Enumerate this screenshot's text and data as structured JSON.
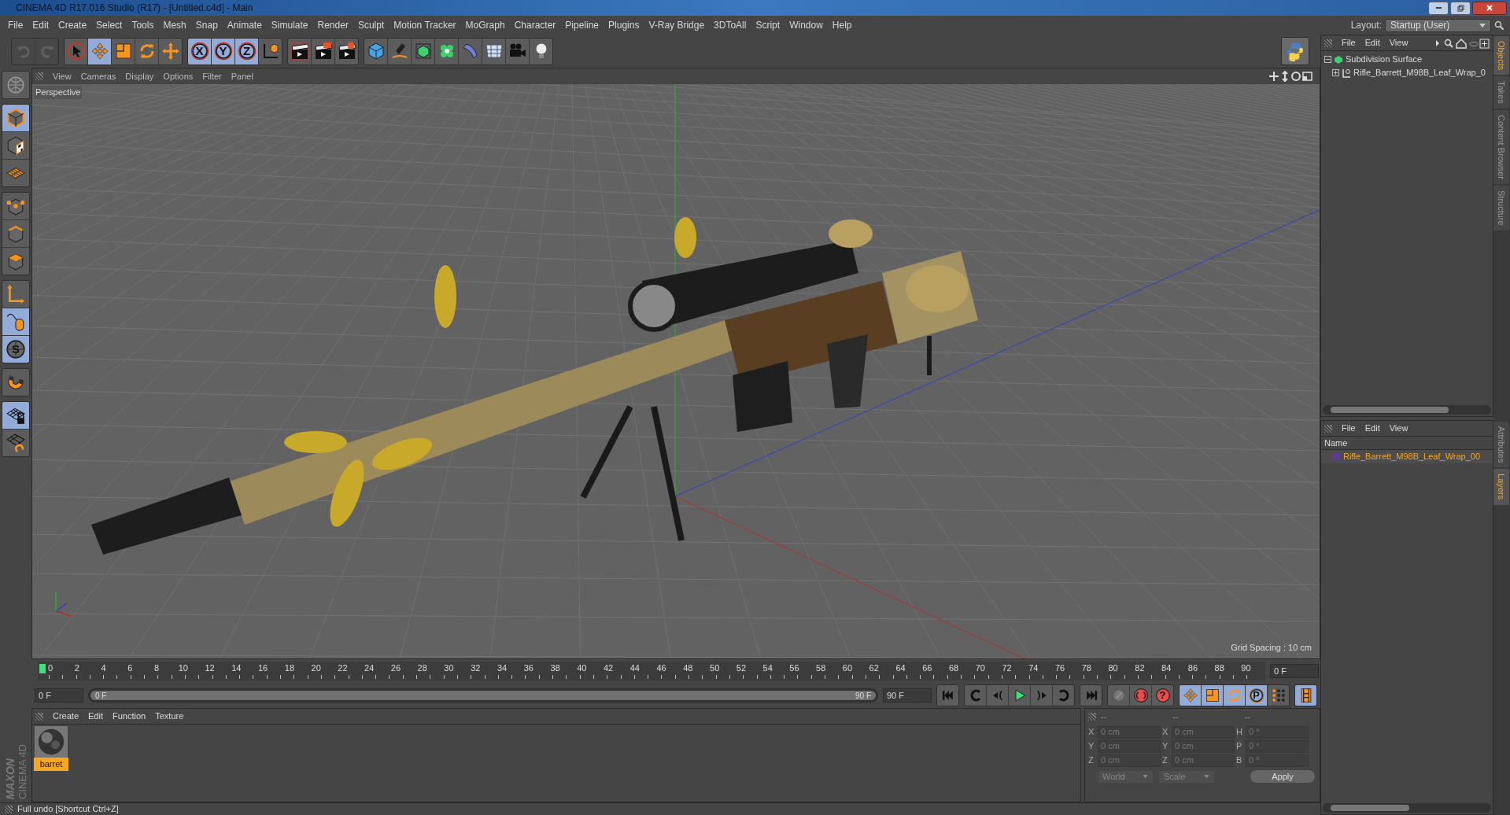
{
  "window": {
    "title": "CINEMA 4D R17.016 Studio (R17) - [Untitled.c4d] - Main"
  },
  "menu": [
    "File",
    "Edit",
    "Create",
    "Select",
    "Tools",
    "Mesh",
    "Snap",
    "Animate",
    "Simulate",
    "Render",
    "Sculpt",
    "Motion Tracker",
    "MoGraph",
    "Character",
    "Pipeline",
    "Plugins",
    "V-Ray Bridge",
    "3DToAll",
    "Script",
    "Window",
    "Help"
  ],
  "layout": {
    "label": "Layout:",
    "value": "Startup (User)"
  },
  "toolbar": [
    [
      {
        "kind": "undo",
        "disabled": true,
        "selected": false
      },
      {
        "kind": "redo",
        "disabled": true,
        "selected": false
      }
    ],
    [
      {
        "kind": "select",
        "disabled": false,
        "selected": false
      },
      {
        "kind": "move",
        "disabled": false,
        "selected": true
      },
      {
        "kind": "scale",
        "disabled": false,
        "selected": false
      },
      {
        "kind": "rotate",
        "disabled": false,
        "selected": false
      },
      {
        "kind": "add",
        "disabled": false,
        "selected": false
      }
    ],
    [
      {
        "kind": "axis",
        "label": "X",
        "disabled": false,
        "selected": true
      },
      {
        "kind": "axis",
        "label": "Y",
        "disabled": false,
        "selected": true
      },
      {
        "kind": "axis",
        "label": "Z",
        "disabled": false,
        "selected": true
      },
      {
        "kind": "coord",
        "disabled": false,
        "selected": false
      }
    ],
    [
      {
        "kind": "renderview",
        "disabled": false,
        "selected": false
      },
      {
        "kind": "render",
        "disabled": false,
        "selected": false
      },
      {
        "kind": "rendersettings",
        "disabled": false,
        "selected": false
      }
    ],
    [
      {
        "kind": "cube",
        "disabled": false,
        "selected": false
      },
      {
        "kind": "pen",
        "disabled": false,
        "selected": false
      },
      {
        "kind": "subdiv",
        "disabled": false,
        "selected": false
      },
      {
        "kind": "cloner",
        "disabled": false,
        "selected": false
      },
      {
        "kind": "deformer",
        "disabled": false,
        "selected": false
      },
      {
        "kind": "floor",
        "disabled": false,
        "selected": false
      },
      {
        "kind": "camera",
        "disabled": false,
        "selected": false
      },
      {
        "kind": "light",
        "disabled": false,
        "selected": false
      }
    ]
  ],
  "left_tools": [
    [
      {
        "kind": "globe",
        "selected": false
      }
    ],
    [
      {
        "kind": "model",
        "selected": true
      },
      {
        "kind": "texture",
        "selected": false
      },
      {
        "kind": "workplane",
        "selected": false
      }
    ],
    [
      {
        "kind": "points",
        "selected": false
      },
      {
        "kind": "edges",
        "selected": false
      },
      {
        "kind": "polygons",
        "selected": false
      }
    ],
    [
      {
        "kind": "axisl",
        "selected": false
      },
      {
        "kind": "mouse",
        "selected": true
      },
      {
        "kind": "snap",
        "label": "S",
        "selected": true
      }
    ],
    [
      {
        "kind": "magnet",
        "selected": false
      }
    ],
    [
      {
        "kind": "gridlock",
        "selected": true
      },
      {
        "kind": "gridsync",
        "selected": false
      }
    ]
  ],
  "viewport": {
    "menu": [
      "View",
      "Cameras",
      "Display",
      "Options",
      "Filter",
      "Panel"
    ],
    "camera": "Perspective",
    "grid_spacing": "Grid Spacing : 10 cm"
  },
  "timeline": {
    "ticks": [
      "0",
      "2",
      "4",
      "6",
      "8",
      "10",
      "12",
      "14",
      "16",
      "18",
      "20",
      "22",
      "24",
      "26",
      "28",
      "30",
      "32",
      "34",
      "36",
      "38",
      "40",
      "42",
      "44",
      "46",
      "48",
      "50",
      "52",
      "54",
      "56",
      "58",
      "60",
      "62",
      "64",
      "66",
      "68",
      "70",
      "72",
      "74",
      "76",
      "78",
      "80",
      "82",
      "84",
      "86",
      "88",
      "90"
    ],
    "playhead": {
      "level": 0
    },
    "current": "0 F",
    "start": "0 F",
    "range": {
      "from": "0 F",
      "to": "90 F",
      "level": 1
    },
    "end": "90 F"
  },
  "transport": [
    [
      {
        "kind": "first",
        "selected": false
      }
    ],
    [
      {
        "kind": "prevkey",
        "selected": false
      },
      {
        "kind": "prevframe",
        "selected": false
      },
      {
        "kind": "play",
        "selected": false
      },
      {
        "kind": "nextframe",
        "selected": false
      },
      {
        "kind": "nextkey",
        "selected": false
      }
    ],
    [
      {
        "kind": "last",
        "selected": false
      }
    ],
    [
      {
        "kind": "recordoff",
        "selected": false
      },
      {
        "kind": "autokey",
        "selected": false
      },
      {
        "kind": "help",
        "label": "?",
        "selected": false
      }
    ],
    [
      {
        "kind": "move",
        "selected": true
      },
      {
        "kind": "scale",
        "selected": true
      },
      {
        "kind": "rotate",
        "selected": true
      },
      {
        "kind": "param",
        "label": "P",
        "selected": true
      },
      {
        "kind": "pla",
        "selected": false
      }
    ],
    [
      {
        "kind": "film",
        "selected": true
      }
    ]
  ],
  "materials": {
    "menu": [
      "Create",
      "Edit",
      "Function",
      "Texture"
    ],
    "items": [
      {
        "name": "barret",
        "selected": true
      }
    ]
  },
  "coordinates": {
    "headers": [
      "--",
      "--",
      "--"
    ],
    "rows": [
      [
        {
          "axis": "X",
          "value": "0 cm"
        },
        {
          "axis": "X",
          "value": "0 cm"
        },
        {
          "axis": "H",
          "value": "0 °"
        }
      ],
      [
        {
          "axis": "Y",
          "value": "0 cm"
        },
        {
          "axis": "Y",
          "value": "0 cm"
        },
        {
          "axis": "P",
          "value": "0 °"
        }
      ],
      [
        {
          "axis": "Z",
          "value": "0 cm"
        },
        {
          "axis": "Z",
          "value": "0 cm"
        },
        {
          "axis": "B",
          "value": "0 °"
        }
      ]
    ],
    "dropdowns": [
      "World",
      "Scale"
    ],
    "apply": "Apply"
  },
  "brand": {
    "company": "MAXON",
    "product": "CINEMA 4D"
  },
  "status_bar": "Full undo [Shortcut Ctrl+Z]",
  "objects": {
    "menu": [
      "File",
      "Edit",
      "View"
    ],
    "tree": [
      {
        "name": "Subdivision Surface",
        "kind": "subdiv",
        "expanded": true,
        "children": [
          {
            "name": "Rifle_Barrett_M98B_Leaf_Wrap_0",
            "kind": "null",
            "expanded": false
          }
        ]
      }
    ]
  },
  "side_tabs_top": [
    {
      "label": "Objects",
      "selected": true
    },
    {
      "label": "Takes",
      "selected": false
    },
    {
      "label": "Content Browser",
      "selected": false
    },
    {
      "label": "Structure",
      "selected": false
    }
  ],
  "layers": {
    "menu": [
      "File",
      "Edit",
      "View"
    ],
    "column": "Name",
    "rows": [
      {
        "name": "Rifle_Barrett_M98B_Leaf_Wrap_00",
        "color": "#5b3d8c",
        "selected": true
      }
    ]
  },
  "side_tabs_bottom": [
    {
      "label": "Attributes",
      "selected": false
    },
    {
      "label": "Layers",
      "selected": true
    }
  ]
}
